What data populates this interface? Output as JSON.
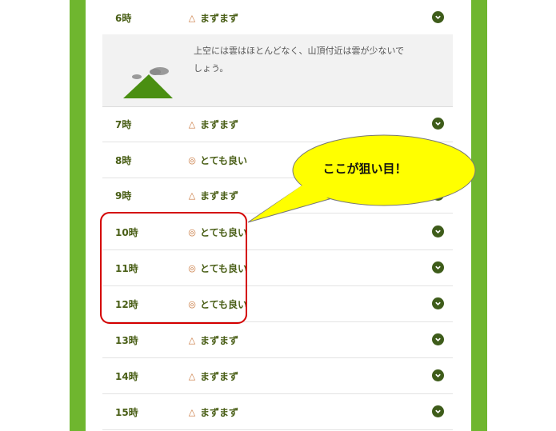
{
  "rows_top": [
    {
      "hour": "6時",
      "mark": "△",
      "condition": "まずまず"
    }
  ],
  "detail": {
    "text": "上空には雲はほとんどなく、山頂付近は雲が少ないでしょう。"
  },
  "rows": [
    {
      "hour": "7時",
      "mark": "△",
      "condition": "まずまず"
    },
    {
      "hour": "8時",
      "mark": "◎",
      "condition": "とても良い"
    },
    {
      "hour": "9時",
      "mark": "△",
      "condition": "まずまず"
    },
    {
      "hour": "10時",
      "mark": "◎",
      "condition": "とても良い"
    },
    {
      "hour": "11時",
      "mark": "◎",
      "condition": "とても良い"
    },
    {
      "hour": "12時",
      "mark": "◎",
      "condition": "とても良い"
    },
    {
      "hour": "13時",
      "mark": "△",
      "condition": "まずまず"
    },
    {
      "hour": "14時",
      "mark": "△",
      "condition": "まずまず"
    },
    {
      "hour": "15時",
      "mark": "△",
      "condition": "まずまず"
    }
  ],
  "callout": {
    "text": "ここが狙い目！"
  },
  "colors": {
    "frame_green": "#6fb62f",
    "text_green": "#4a5f17",
    "highlight_red": "#d40000",
    "bubble_yellow": "#ffff00"
  }
}
